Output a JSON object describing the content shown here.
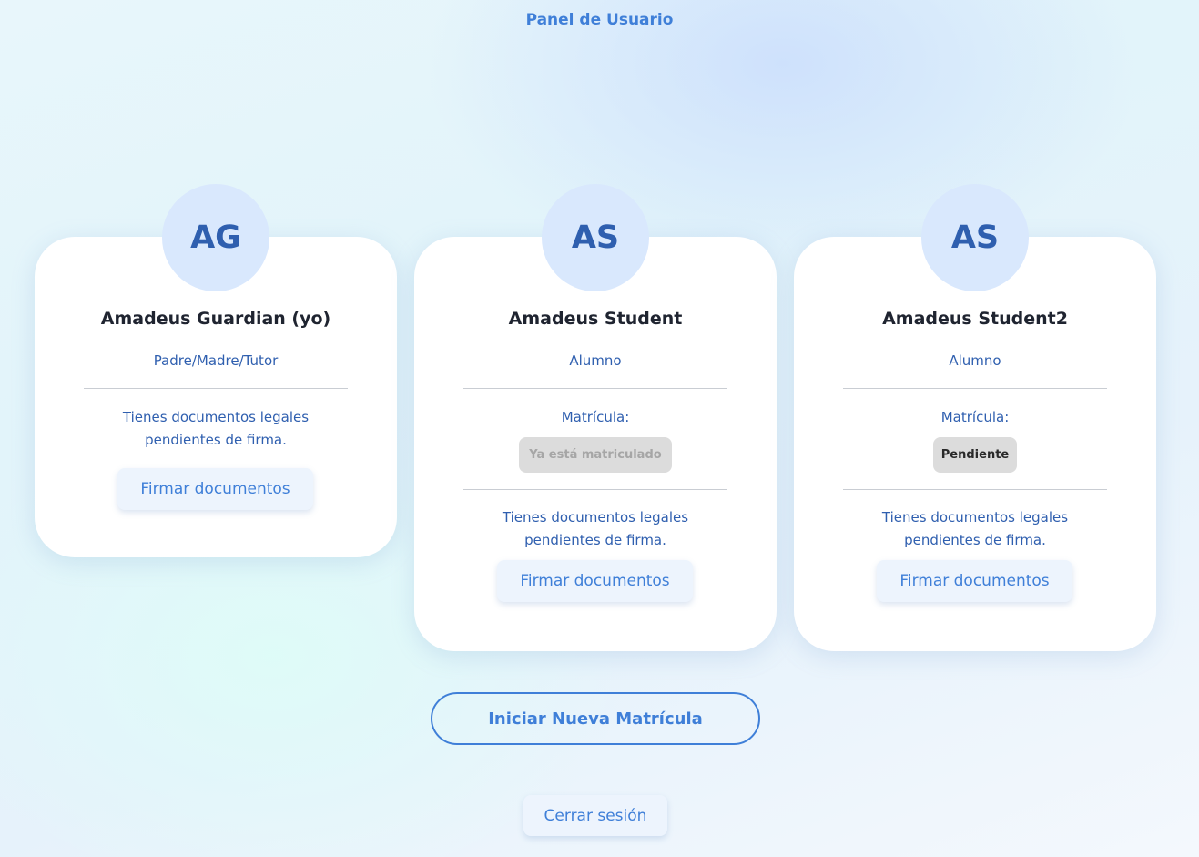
{
  "header": {
    "title": "Panel de Usuario"
  },
  "cards": [
    {
      "initials": "AG",
      "name": "Amadeus Guardian (yo)",
      "role": "Padre/Madre/Tutor",
      "docs_text": "Tienes documentos legales pendientes de firma.",
      "sign_label": "Firmar documentos"
    },
    {
      "initials": "AS",
      "name": "Amadeus Student",
      "role": "Alumno",
      "enrollment_label": "Matrícula:",
      "enrollment_status": "Ya está matriculado",
      "docs_text": "Tienes documentos legales pendientes de firma.",
      "sign_label": "Firmar documentos"
    },
    {
      "initials": "AS",
      "name": "Amadeus Student2",
      "role": "Alumno",
      "enrollment_label": "Matrícula:",
      "enrollment_status": "Pendiente",
      "docs_text": "Tienes documentos legales pendientes de firma.",
      "sign_label": "Firmar documentos"
    }
  ],
  "actions": {
    "new_enrollment_label": "Iniciar Nueva Matrícula",
    "logout_label": "Cerrar sesión"
  },
  "colors": {
    "accent": "#3f7fd8",
    "text_blue": "#2f5faf",
    "avatar_bg": "#d9e8fd",
    "badge_bg": "#dcdcdc"
  }
}
